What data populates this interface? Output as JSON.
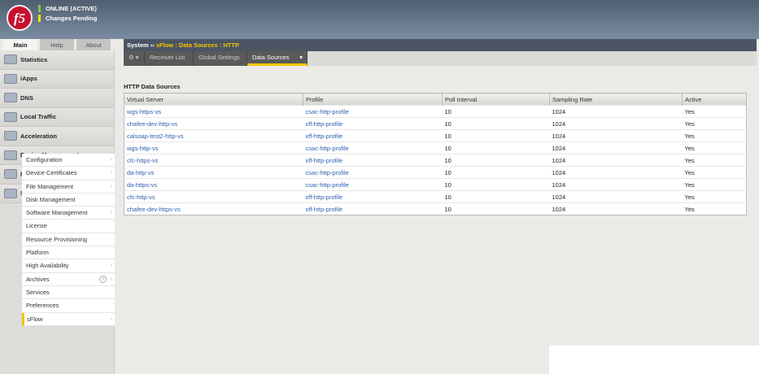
{
  "header": {
    "logo": "f5",
    "status": "ONLINE (ACTIVE)",
    "pending": "Changes Pending"
  },
  "tabs": [
    "Main",
    "Help",
    "About"
  ],
  "nav": [
    "Statistics",
    "iApps",
    "DNS",
    "Local Traffic",
    "Acceleration",
    "Device Management",
    "Network",
    "System"
  ],
  "submenu": [
    {
      "label": "Configuration",
      "arrow": true
    },
    {
      "label": "Device Certificates",
      "arrow": true
    },
    {
      "label": "File Management",
      "arrow": true
    },
    {
      "label": "Disk Management",
      "arrow": false
    },
    {
      "label": "Software Management",
      "arrow": true
    },
    {
      "label": "License",
      "arrow": false
    },
    {
      "label": "Resource Provisioning",
      "arrow": false
    },
    {
      "label": "Platform",
      "arrow": false
    },
    {
      "label": "High Availability",
      "arrow": true
    },
    {
      "label": "Archives",
      "arrow": true
    },
    {
      "label": "Services",
      "arrow": false
    },
    {
      "label": "Preferences",
      "arrow": false
    },
    {
      "label": "sFlow",
      "arrow": true
    }
  ],
  "breadcrumb": {
    "root": "System",
    "sep": "››",
    "path": "sFlow : Data Sources : HTTP"
  },
  "menubar": {
    "gear": "⚙ ▾",
    "items": [
      "Receiver List",
      "Global Settings",
      "Data Sources"
    ],
    "dropdown": "▾"
  },
  "section_title": "HTTP Data Sources",
  "table": {
    "columns": [
      "Virtual Server",
      "Profile",
      "Poll Interval",
      "Sampling Rate",
      "Active"
    ],
    "rows": [
      [
        "wgs-https-vs",
        "csac-http-profile",
        "10",
        "1024",
        "Yes"
      ],
      [
        "chafee-dev-http-vs",
        "xff-http-profile",
        "10",
        "1024",
        "Yes"
      ],
      [
        "calsoap-test2-http-vs",
        "xff-http-profile",
        "10",
        "1024",
        "Yes"
      ],
      [
        "wgs-http-vs",
        "csac-http-profile",
        "10",
        "1024",
        "Yes"
      ],
      [
        "cfc-https-vs",
        "xff-http-profile",
        "10",
        "1024",
        "Yes"
      ],
      [
        "da-http-vs",
        "csac-http-profile",
        "10",
        "1024",
        "Yes"
      ],
      [
        "da-https-vs",
        "csac-http-profile",
        "10",
        "1024",
        "Yes"
      ],
      [
        "cfc-http-vs",
        "xff-http-profile",
        "10",
        "1024",
        "Yes"
      ],
      [
        "chafee-dev-https-vs",
        "xff-http-profile",
        "10",
        "1024",
        "Yes"
      ]
    ]
  }
}
